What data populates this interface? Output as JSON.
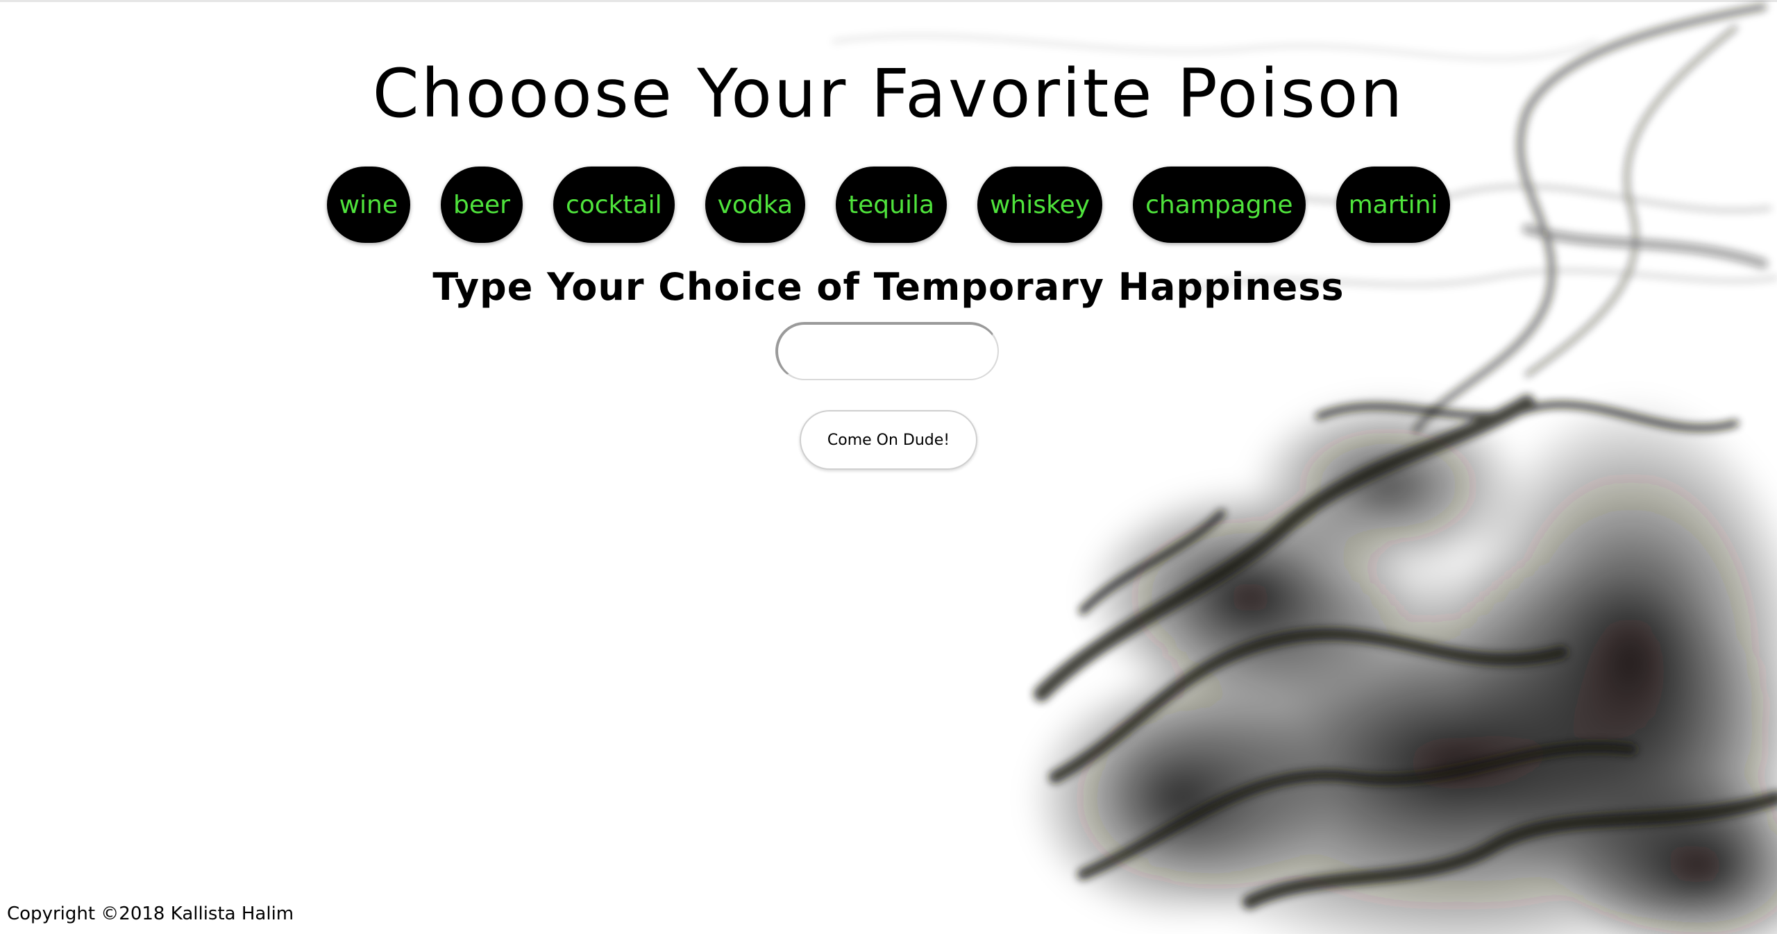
{
  "page": {
    "title": "Chooose Your Favorite Poison",
    "drinks": [
      "wine",
      "beer",
      "cocktail",
      "vodka",
      "tequila",
      "whiskey",
      "champagne",
      "martini"
    ],
    "prompt": "Type Your Choice of Temporary Happiness",
    "input_value": "",
    "submit_label": "Come On Dude!",
    "copyright": "Copyright ©2018 Kallista Halim"
  },
  "colors": {
    "drink_button_bg": "#000000",
    "drink_button_text": "#4fe43c",
    "background": "#ffffff",
    "smoke": "#141210"
  },
  "background_image": "black-ink-smoke"
}
